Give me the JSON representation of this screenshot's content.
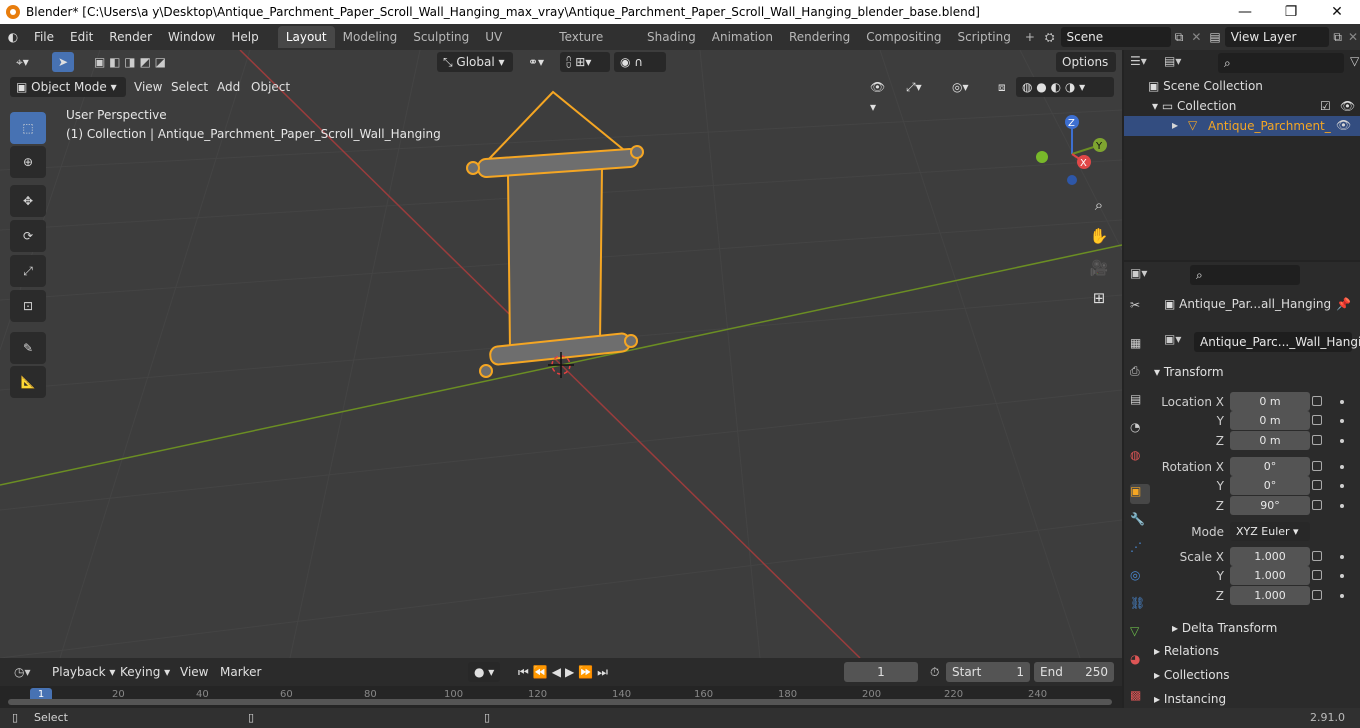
{
  "window": {
    "title": "Blender* [C:\\Users\\a y\\Desktop\\Antique_Parchment_Paper_Scroll_Wall_Hanging_max_vray\\Antique_Parchment_Paper_Scroll_Wall_Hanging_blender_base.blend]",
    "minimize": "—",
    "maximize": "❐",
    "close": "✕"
  },
  "menu": {
    "items": [
      "File",
      "Edit",
      "Render",
      "Window",
      "Help"
    ]
  },
  "workspaces": {
    "tabs": [
      "Layout",
      "Modeling",
      "Sculpting",
      "UV Editing",
      "Texture Paint",
      "Shading",
      "Animation",
      "Rendering",
      "Compositing",
      "Scripting"
    ],
    "active": "Layout"
  },
  "scene": {
    "label": "Scene"
  },
  "view_layer": {
    "label": "View Layer"
  },
  "toolbar": {
    "orientation": "Global",
    "options": "Options"
  },
  "viewport_header": {
    "mode": "Object Mode",
    "view": "View",
    "select": "Select",
    "add": "Add",
    "object": "Object"
  },
  "viewport": {
    "perspective": "User Perspective",
    "collection_info": "(1) Collection | Antique_Parchment_Paper_Scroll_Wall_Hanging"
  },
  "gizmo": {
    "z": "Z",
    "y": "Y",
    "x": "X"
  },
  "outliner": {
    "scene_collection": "Scene Collection",
    "collection": "Collection",
    "object": "Antique_Parchment_"
  },
  "properties": {
    "object_name": "Antique_Par...all_Hanging",
    "data_name": "Antique_Parc..._Wall_Hanging",
    "transform_label": "Transform",
    "location": {
      "label_x": "Location X",
      "label_y": "Y",
      "label_z": "Z",
      "x": "0 m",
      "y": "0 m",
      "z": "0 m"
    },
    "rotation": {
      "label_x": "Rotation X",
      "label_y": "Y",
      "label_z": "Z",
      "x": "0°",
      "y": "0°",
      "z": "90°"
    },
    "mode": {
      "label": "Mode",
      "value": "XYZ Euler"
    },
    "scale": {
      "label_x": "Scale X",
      "label_y": "Y",
      "label_z": "Z",
      "x": "1.000",
      "y": "1.000",
      "z": "1.000"
    },
    "delta": "Delta Transform",
    "relations": "Relations",
    "collections": "Collections",
    "instancing": "Instancing"
  },
  "timeline": {
    "playback": "Playback",
    "keying": "Keying",
    "view": "View",
    "marker": "Marker",
    "current_frame": "1",
    "start_label": "Start",
    "start": "1",
    "end_label": "End",
    "end": "250",
    "ruler": [
      "1",
      "20",
      "40",
      "60",
      "80",
      "100",
      "120",
      "140",
      "160",
      "180",
      "200",
      "220",
      "240"
    ]
  },
  "status": {
    "select": "Select",
    "version": "2.91.0"
  },
  "colors": {
    "accent": "#4772b3",
    "selection": "#f5a623",
    "x_axis": "#9a3c3c",
    "y_axis": "#6b8e23",
    "bg": "#3d3d3d"
  }
}
